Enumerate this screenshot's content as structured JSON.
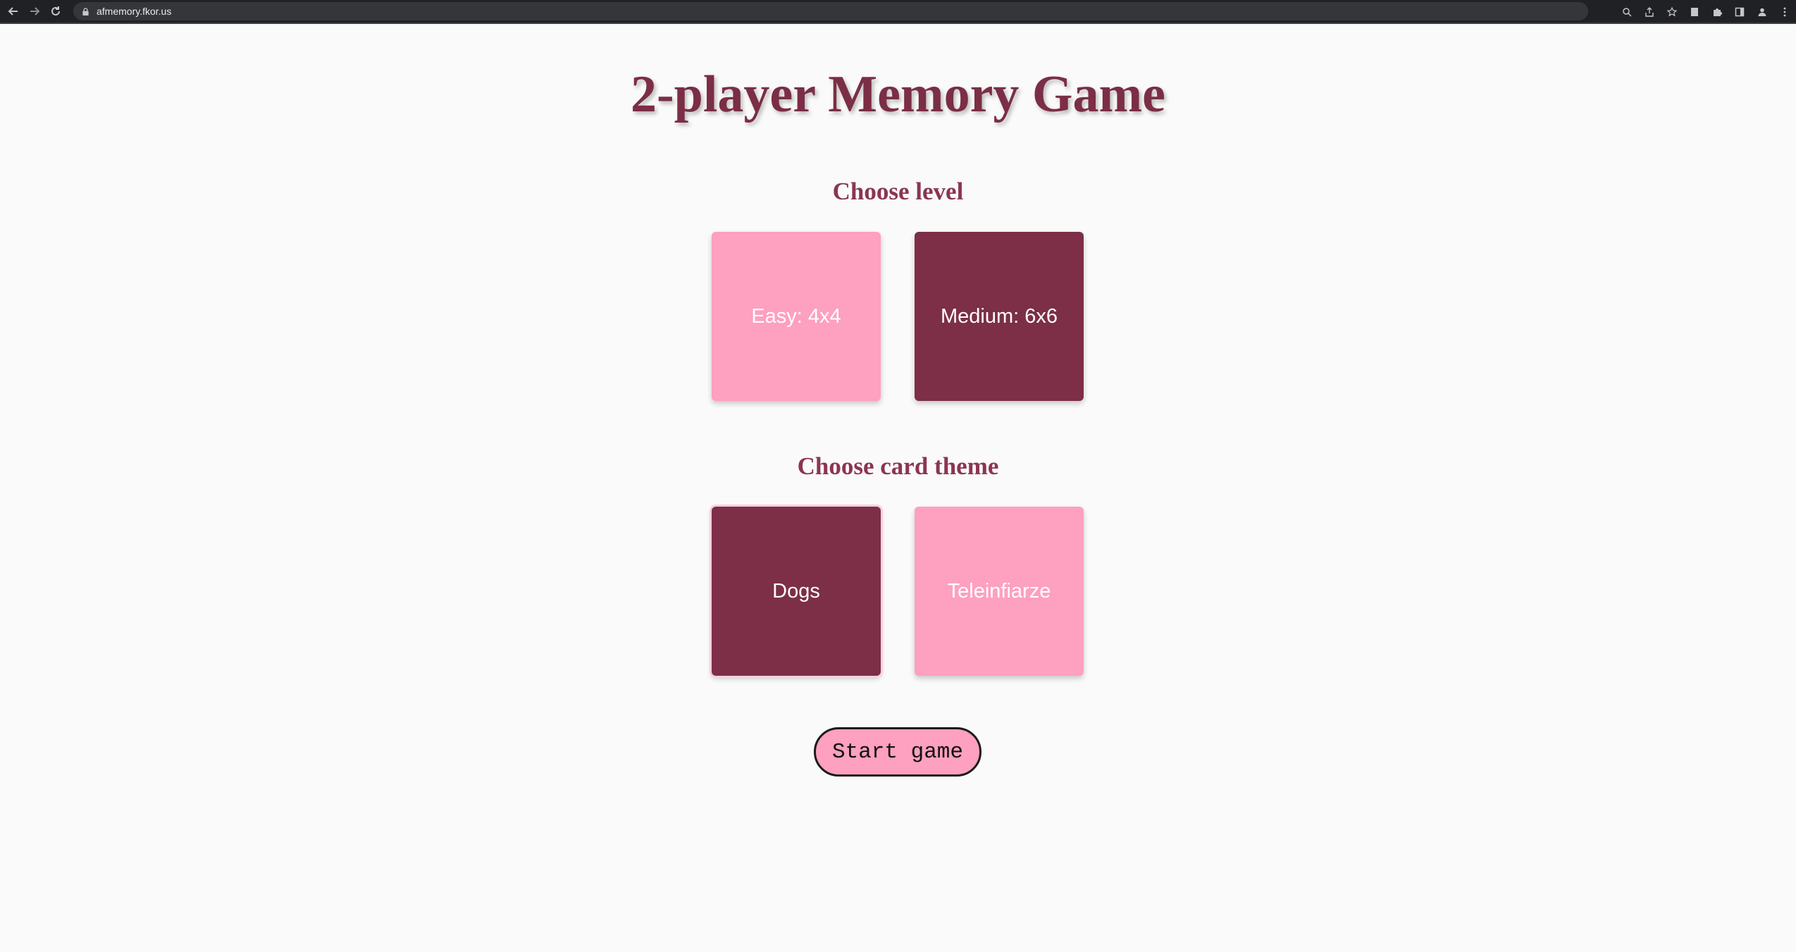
{
  "browser": {
    "url": "afmemory.fkor.us",
    "nav_icons": [
      "back-icon",
      "forward-icon",
      "reload-icon"
    ],
    "action_icons": [
      "zoom-icon",
      "share-icon",
      "star-icon",
      "extension-page-icon",
      "puzzle-icon",
      "sidepanel-icon",
      "profile-icon",
      "more-icon"
    ]
  },
  "page": {
    "title": "2-player Memory Game",
    "level_heading": "Choose level",
    "levels": [
      {
        "label": "Easy: 4x4",
        "color": "#fea0bf"
      },
      {
        "label": "Medium: 6x6",
        "color": "#7c2f47"
      }
    ],
    "theme_heading": "Choose card theme",
    "themes": [
      {
        "label": "Dogs",
        "color": "#7c2f47"
      },
      {
        "label": "Teleinfiarze",
        "color": "#fea0bf"
      }
    ],
    "start_label": "Start game"
  },
  "colors": {
    "title": "#7b2e45",
    "heading": "#8b3553",
    "pink": "#fea0bf",
    "dark": "#7c2f47",
    "background": "#fafafa"
  }
}
